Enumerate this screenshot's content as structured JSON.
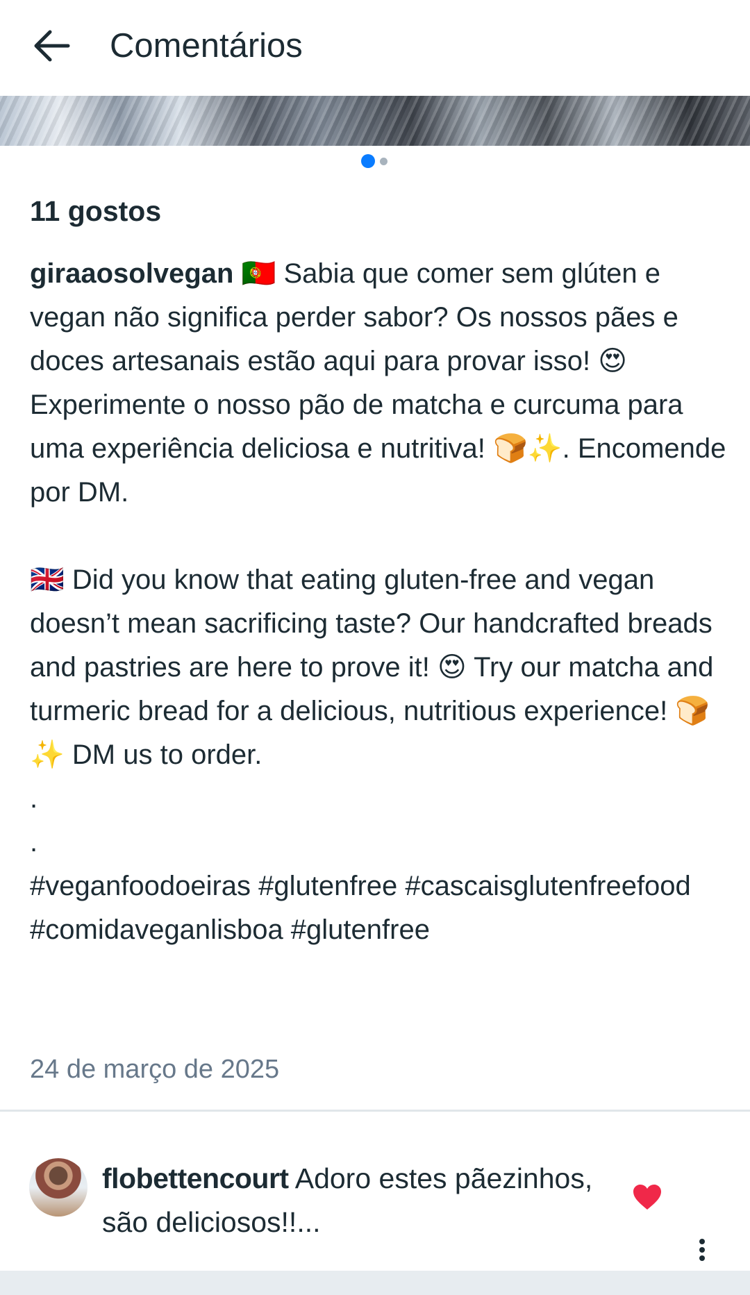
{
  "header": {
    "title": "Comentários",
    "back_icon": "arrow-left-icon"
  },
  "carousel": {
    "total": 2,
    "active_index": 0,
    "active_color": "#0a7cff",
    "inactive_color": "#a8b3bd"
  },
  "post": {
    "likes": "11 gostos",
    "username": "giraaosolvegan",
    "caption": " 🇵🇹 Sabia que comer sem glúten e vegan não significa perder sabor? Os nossos pães e doces artesanais estão aqui para provar isso! 😍 Experimente o nosso pão de matcha e curcuma para uma experiência deliciosa e nutritiva! 🍞✨. Encomende por DM.\n\n🇬🇧 Did you know that eating gluten-free and vegan doesn’t mean sacrificing taste? Our handcrafted breads and pastries are here to prove it! 😍 Try our matcha and turmeric bread for a delicious, nutritious experience! 🍞✨ DM us to order.\n.\n.\n#veganfoodoeiras #glutenfree #cascaisglutenfreefood #comidaveganlisboa #glutenfree",
    "date": "24 de março de 2025"
  },
  "comments": [
    {
      "username": "flobettencourt",
      "text": " Adoro estes pãezinhos, são deliciosos!!...",
      "liked": true,
      "like_color": "#f02849",
      "heart_icon": "heart-icon",
      "more_icon": "more-vertical-icon"
    }
  ],
  "colors": {
    "text": "#1c2b33",
    "secondary_text": "#67788a",
    "divider": "#e1e6ea"
  }
}
